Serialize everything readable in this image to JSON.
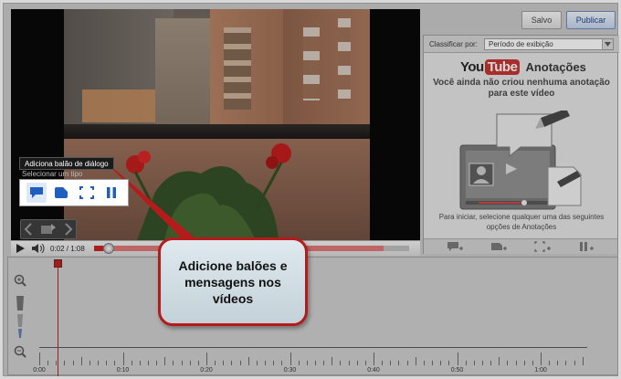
{
  "toolbar": {
    "save_label": "Salvo",
    "publish_label": "Publicar"
  },
  "player": {
    "tooltip": "Adiciona balão de diálogo",
    "subtip": "Selecionar um tipo",
    "time_display": "0:02 / 1:08",
    "progress_played": 0.03,
    "progress_loaded": 0.92,
    "annotation_tools": [
      "speech-bubble-icon",
      "note-icon",
      "spotlight-icon",
      "pause-icon"
    ]
  },
  "panel": {
    "sort_label": "Classificar por:",
    "sort_value": "Período de exibição",
    "logo_you": "You",
    "logo_tube": "Tube",
    "logo_title": "Anotações",
    "empty_message": "Você ainda não criou nenhuma anotação para este vídeo",
    "start_message": "Para iniciar, selecione qualquer uma das seguintes opções de Anotações"
  },
  "timeline": {
    "tick_labels": [
      "0:00",
      "0:10",
      "0:20",
      "0:30",
      "0:40",
      "0:50",
      "1:00"
    ]
  },
  "callout": {
    "text": "Adicione balões e mensagens nos vídeos"
  },
  "colors": {
    "accent_red": "#b51b1b",
    "progress_red": "#cc1b1b",
    "publish_blue": "#1f3f80"
  }
}
